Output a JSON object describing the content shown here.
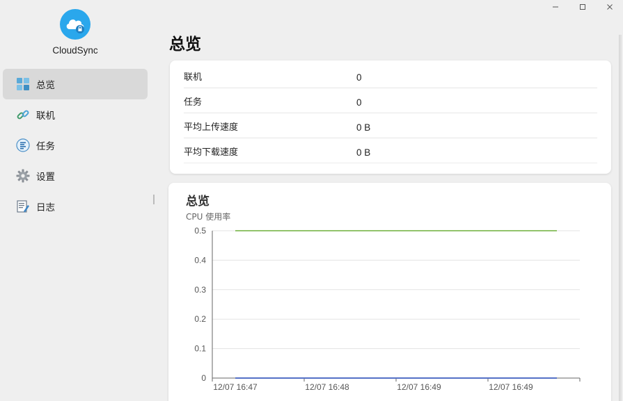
{
  "window": {
    "minimize_icon": "minimize-icon",
    "maximize_icon": "maximize-icon",
    "close_icon": "close-icon"
  },
  "app": {
    "name": "CloudSync",
    "logo_icon": "cloud-lock-icon",
    "accent": "#2aa7ec"
  },
  "sidebar": {
    "items": [
      {
        "label": "总览",
        "icon": "dashboard-grid-icon",
        "active": true
      },
      {
        "label": "联机",
        "icon": "link-icon",
        "active": false
      },
      {
        "label": "任务",
        "icon": "task-list-icon",
        "active": false
      },
      {
        "label": "设置",
        "icon": "gear-icon",
        "active": false
      },
      {
        "label": "日志",
        "icon": "log-document-icon",
        "active": false
      }
    ]
  },
  "main": {
    "title": "总览",
    "info": [
      {
        "label": "联机",
        "value": "0"
      },
      {
        "label": "任务",
        "value": "0"
      },
      {
        "label": "平均上传速度",
        "value": "0 B"
      },
      {
        "label": "平均下载速度",
        "value": "0 B"
      }
    ],
    "chart_card": {
      "title": "总览"
    }
  },
  "chart_data": {
    "type": "line",
    "title": "CPU 使用率",
    "x": [
      "12/07 16:47",
      "12/07 16:48",
      "12/07 16:49",
      "12/07 16:49"
    ],
    "ylim": [
      0,
      0.5
    ],
    "yticks": [
      "0.5",
      "0.4",
      "0.3",
      "0.2",
      "0.1",
      "0"
    ],
    "grid": true,
    "series": [
      {
        "values": [
          0.5,
          0.5,
          0.5,
          0.5
        ],
        "color": "#91c36b"
      },
      {
        "values": [
          0,
          0,
          0,
          0
        ],
        "color": "#5470c6"
      }
    ]
  }
}
